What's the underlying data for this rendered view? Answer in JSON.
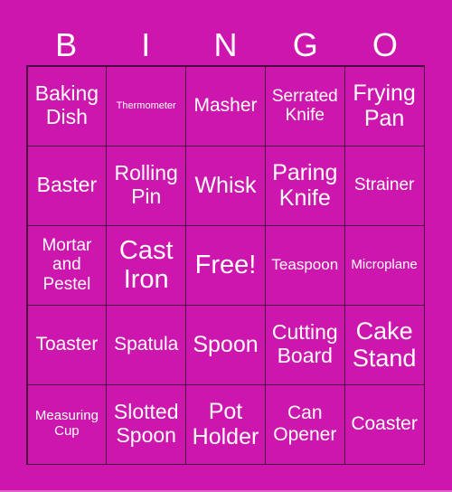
{
  "header": [
    "B",
    "I",
    "N",
    "G",
    "O"
  ],
  "cells": [
    "Baking Dish",
    "Thermometer",
    "Masher",
    "Serrated Knife",
    "Frying Pan",
    "Baster",
    "Rolling Pin",
    "Whisk",
    "Paring Knife",
    "Strainer",
    "Mortar and Pestel",
    "Cast Iron",
    "Free!",
    "Teaspoon",
    "Microplane",
    "Toaster",
    "Spatula",
    "Spoon",
    "Cutting Board",
    "Cake Stand",
    "Measuring Cup",
    "Slotted Spoon",
    "Pot Holder",
    "Can Opener",
    "Coaster"
  ],
  "colors": {
    "background": "#CD16AD",
    "grid_line": "#4a0a40",
    "text": "#ffffff"
  }
}
